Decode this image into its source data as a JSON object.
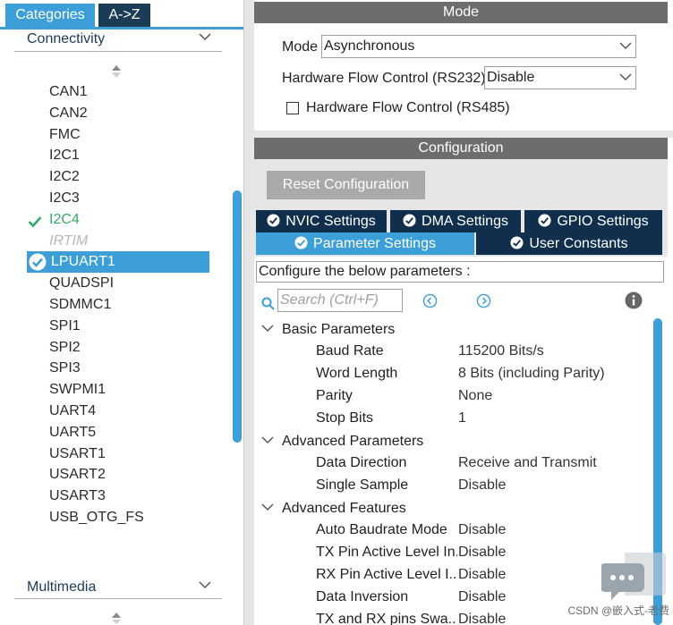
{
  "left_panel": {
    "tabs": [
      {
        "label": "Categories",
        "active": true
      },
      {
        "label": "A->Z",
        "active": false
      }
    ],
    "connectivity_header": "Connectivity",
    "multimedia_header": "Multimedia",
    "peripherals": [
      {
        "label": "CAN1",
        "state": "normal"
      },
      {
        "label": "CAN2",
        "state": "normal"
      },
      {
        "label": "FMC",
        "state": "normal"
      },
      {
        "label": "I2C1",
        "state": "normal"
      },
      {
        "label": "I2C2",
        "state": "normal"
      },
      {
        "label": "I2C3",
        "state": "normal"
      },
      {
        "label": "I2C4",
        "state": "configured"
      },
      {
        "label": "IRTIM",
        "state": "disabled"
      },
      {
        "label": "LPUART1",
        "state": "selected"
      },
      {
        "label": "QUADSPI",
        "state": "normal"
      },
      {
        "label": "SDMMC1",
        "state": "normal"
      },
      {
        "label": "SPI1",
        "state": "normal"
      },
      {
        "label": "SPI2",
        "state": "normal"
      },
      {
        "label": "SPI3",
        "state": "normal"
      },
      {
        "label": "SWPMI1",
        "state": "normal"
      },
      {
        "label": "UART4",
        "state": "normal"
      },
      {
        "label": "UART5",
        "state": "normal"
      },
      {
        "label": "USART1",
        "state": "normal"
      },
      {
        "label": "USART2",
        "state": "normal"
      },
      {
        "label": "USART3",
        "state": "normal"
      },
      {
        "label": "USB_OTG_FS",
        "state": "normal"
      }
    ]
  },
  "mode": {
    "title": "Mode",
    "mode_label": "Mode",
    "mode_value": "Asynchronous",
    "hw_flow_label": "Hardware Flow Control (RS232)",
    "hw_flow_value": "Disable",
    "rs485_label": "Hardware Flow Control (RS485)",
    "rs485_checked": false
  },
  "configuration": {
    "title": "Configuration",
    "reset_label": "Reset Configuration",
    "tabs_row1": [
      "NVIC Settings",
      "DMA Settings",
      "GPIO Settings"
    ],
    "tabs_row2": [
      "Parameter Settings",
      "User Constants"
    ],
    "active_tab": "Parameter Settings",
    "note": "Configure the below parameters :",
    "search_placeholder": "Search (Ctrl+F)",
    "groups": [
      {
        "name": "Basic Parameters",
        "params": [
          {
            "name": "Baud Rate",
            "value": "115200 Bits/s"
          },
          {
            "name": "Word Length",
            "value": "8 Bits (including Parity)"
          },
          {
            "name": "Parity",
            "value": "None"
          },
          {
            "name": "Stop Bits",
            "value": "1"
          }
        ]
      },
      {
        "name": "Advanced Parameters",
        "params": [
          {
            "name": "Data Direction",
            "value": "Receive and Transmit"
          },
          {
            "name": "Single Sample",
            "value": "Disable"
          }
        ]
      },
      {
        "name": "Advanced Features",
        "params": [
          {
            "name": "Auto Baudrate Mode",
            "value": "Disable"
          },
          {
            "name": "TX Pin Active Level In...",
            "value": "Disable"
          },
          {
            "name": "RX Pin Active Level I...",
            "value": "Disable"
          },
          {
            "name": "Data Inversion",
            "value": "Disable"
          },
          {
            "name": "TX and RX pins Swa...",
            "value": "Disable"
          }
        ]
      }
    ]
  },
  "watermark": "CSDN @嵌入式-老费",
  "colors": {
    "accent_blue": "#3d9fd7",
    "dark_navy": "#0f2f4d",
    "configured_green": "#33aa66",
    "header_gray": "#6d6d6d"
  },
  "icons": [
    "chevron-down-icon",
    "sort-icon",
    "check-icon",
    "selected-check-icon",
    "search-icon",
    "prev-icon",
    "next-icon",
    "info-icon",
    "chat-icon"
  ]
}
